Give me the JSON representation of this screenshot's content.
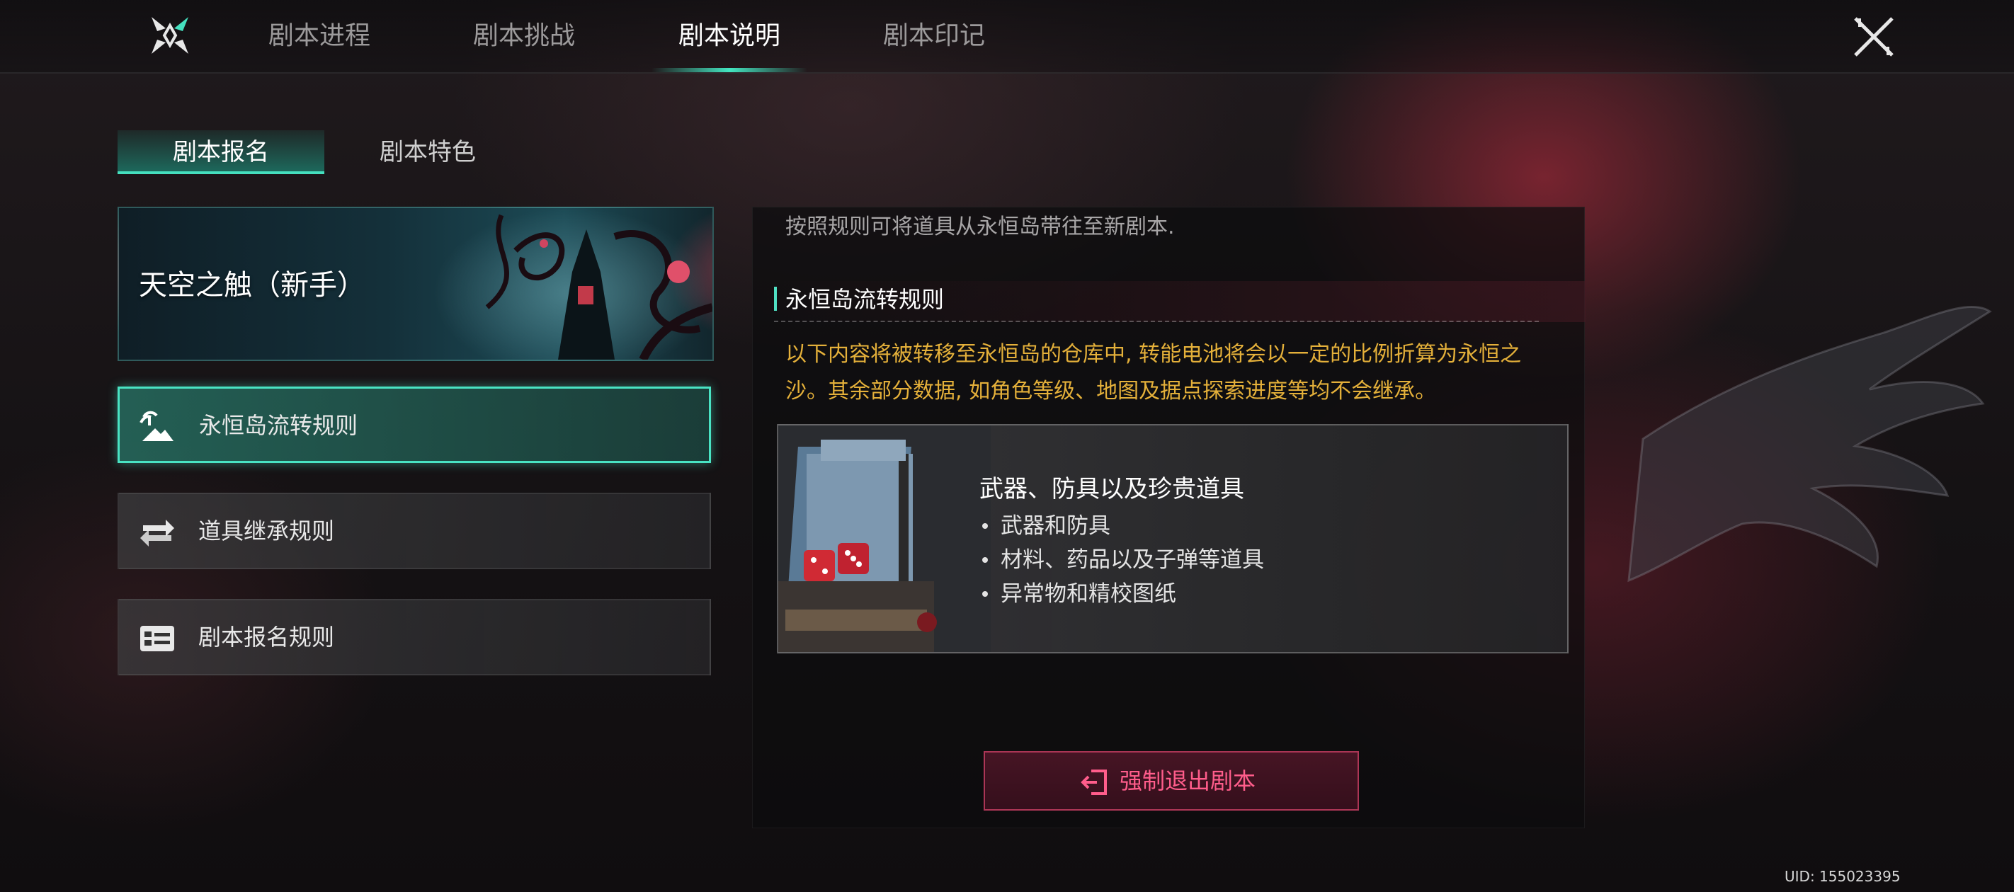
{
  "topbar": {
    "tabs": [
      {
        "label": "剧本进程"
      },
      {
        "label": "剧本挑战"
      },
      {
        "label": "剧本说明"
      },
      {
        "label": "剧本印记"
      }
    ],
    "active_tab": "剧本说明"
  },
  "subtabs": [
    {
      "label": "剧本报名"
    },
    {
      "label": "剧本特色"
    }
  ],
  "banner": {
    "title": "天空之触（新手）"
  },
  "menu": [
    {
      "label": "永恒岛流转规则",
      "icon": "island-icon"
    },
    {
      "label": "道具继承规则",
      "icon": "swap-arrows-icon"
    },
    {
      "label": "剧本报名规则",
      "icon": "id-card-icon"
    }
  ],
  "panel": {
    "intro": "按照规则可将道具从永恒岛带往至新剧本.",
    "section_title": "永恒岛流转规则",
    "warning": "以下内容将被转移至永恒岛的仓库中, 转能电池将会以一定的比例折算为永恒之沙。其余部分数据, 如角色等级、地图及据点探索进度等均不会继承。",
    "card": {
      "title": "武器、防具以及珍贵道具",
      "items": [
        "武器和防具",
        "材料、药品以及子弹等道具",
        "异常物和精校图纸"
      ]
    },
    "exit_button": "强制退出剧本"
  },
  "uid": "UID: 155023395",
  "colors": {
    "accent": "#45e0bf",
    "warning": "#e4b03a",
    "danger": "#ff5d8b"
  }
}
